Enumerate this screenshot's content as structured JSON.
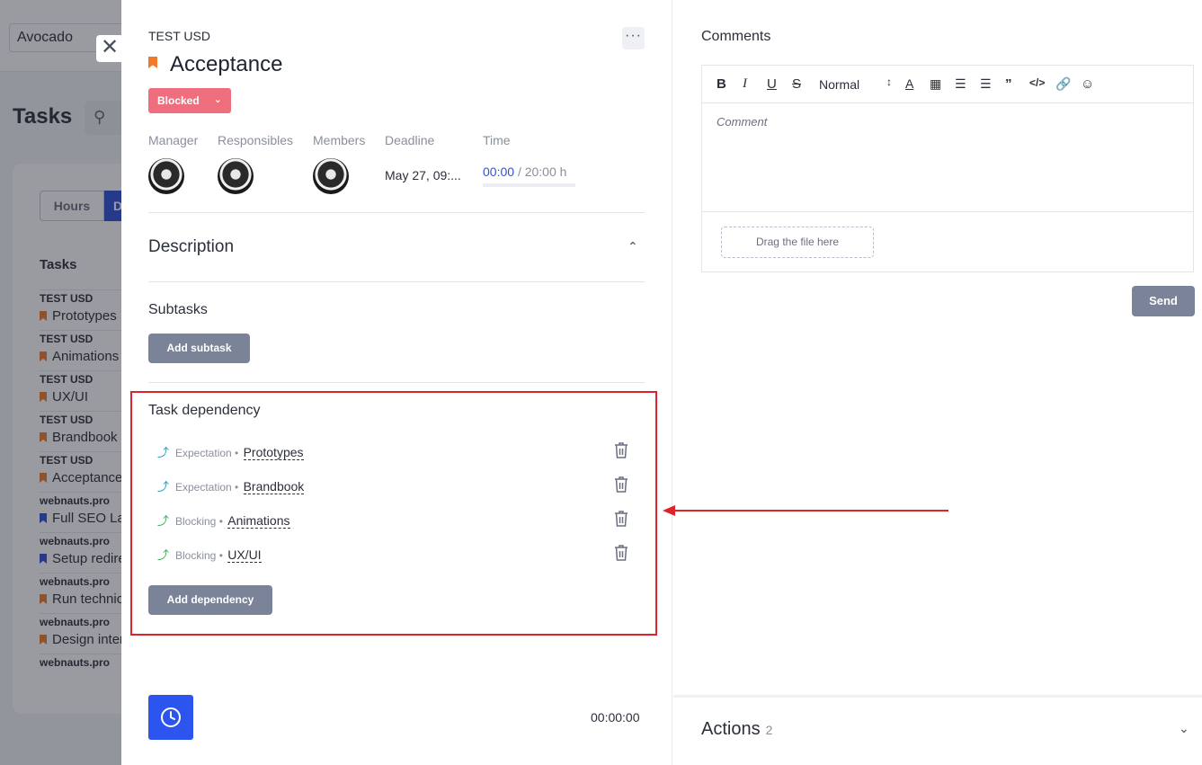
{
  "background": {
    "project_selector": "Avocado",
    "title": "Tasks",
    "tabs": [
      "Hours",
      "D"
    ],
    "list_title": "Tasks",
    "rows": [
      {
        "project": "TEST USD",
        "name": "Prototypes",
        "color": "#ee7a2a"
      },
      {
        "project": "TEST USD",
        "name": "Animations",
        "color": "#ee7a2a"
      },
      {
        "project": "TEST USD",
        "name": "UX/UI",
        "color": "#ee7a2a"
      },
      {
        "project": "TEST USD",
        "name": "Brandbook",
        "color": "#ee7a2a"
      },
      {
        "project": "TEST USD",
        "name": "Acceptance",
        "color": "#ee7a2a"
      },
      {
        "project": "webnauts.pro",
        "name": "Full SEO Lau",
        "color": "#2c4fd6"
      },
      {
        "project": "webnauts.pro",
        "name": "Setup redire",
        "color": "#2c4fd6"
      },
      {
        "project": "webnauts.pro",
        "name": "Run technic",
        "color": "#ee7a2a"
      },
      {
        "project": "webnauts.pro",
        "name": "Design inter",
        "color": "#ee7a2a"
      },
      {
        "project": "webnauts.pro",
        "name": "",
        "color": ""
      }
    ]
  },
  "task": {
    "project": "TEST USD",
    "title": "Acceptance",
    "status": "Blocked",
    "more_icon": "more-horizontal-icon",
    "meta": {
      "manager_label": "Manager",
      "responsibles_label": "Responsibles",
      "members_label": "Members",
      "deadline_label": "Deadline",
      "time_label": "Time",
      "deadline": "May 27, 09:...",
      "time_spent": "00:00",
      "time_total": "/ 20:00 h"
    },
    "description_title": "Description",
    "subtasks_title": "Subtasks",
    "add_subtask": "Add subtask",
    "dependency_title": "Task dependency",
    "dependencies": [
      {
        "type": "Expectation",
        "name": "Prototypes",
        "kind": "exp"
      },
      {
        "type": "Expectation",
        "name": "Brandbook",
        "kind": "exp"
      },
      {
        "type": "Blocking",
        "name": "Animations",
        "kind": "blk"
      },
      {
        "type": "Blocking",
        "name": "UX/UI",
        "kind": "blk"
      }
    ],
    "add_dependency": "Add dependency",
    "timer_value": "00:00:00"
  },
  "comments": {
    "title": "Comments",
    "format_select": "Normal",
    "placeholder": "Comment",
    "drop_zone": "Drag the file here",
    "send": "Send"
  },
  "actions": {
    "title": "Actions",
    "count": "2"
  },
  "colors": {
    "accent_blue": "#2c55f0",
    "blocked_red": "#ee6e7d",
    "highlight_red": "#e0222a",
    "button_gray": "#7b8399"
  }
}
